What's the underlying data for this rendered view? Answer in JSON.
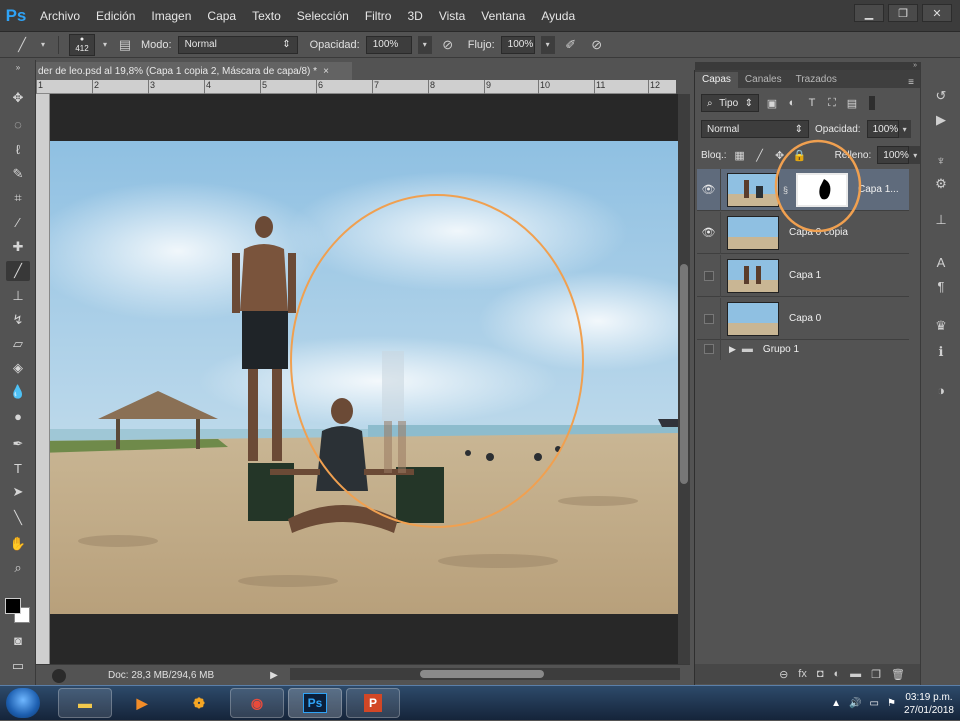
{
  "app": {
    "logo": "Ps",
    "menu": [
      "Archivo",
      "Edición",
      "Imagen",
      "Capa",
      "Texto",
      "Selección",
      "Filtro",
      "3D",
      "Vista",
      "Ventana",
      "Ayuda"
    ],
    "window_controls": [
      "minimize",
      "restore",
      "close"
    ]
  },
  "options_bar": {
    "brush_size": "412",
    "mode_label": "Modo:",
    "mode_value": "Normal",
    "opacity_label": "Opacidad:",
    "opacity_value": "100%",
    "flow_label": "Flujo:",
    "flow_value": "100%"
  },
  "document": {
    "tab_title": "der de leo.psd al 19,8% (Capa 1 copia 2, Máscara de capa/8) *",
    "close": "×",
    "ruler_numbers": [
      "1",
      "2",
      "3",
      "4",
      "5",
      "6",
      "7",
      "8",
      "9",
      "10",
      "11",
      "12"
    ],
    "status": "Doc: 28,3 MB/294,6 MB"
  },
  "layers_panel": {
    "tabs": [
      "Capas",
      "Canales",
      "Trazados"
    ],
    "filter_value": "Tipo",
    "blend_value": "Normal",
    "opacity_label": "Opacidad:",
    "opacity_value": "100%",
    "lock_label": "Bloq.:",
    "fill_label": "Relleno:",
    "fill_value": "100%",
    "layers": [
      {
        "name": "Capa 1...",
        "visible": true,
        "selected": true,
        "has_mask": true
      },
      {
        "name": "Capa 0 copia",
        "visible": true,
        "selected": false,
        "has_mask": false
      },
      {
        "name": "Capa 1",
        "visible": false,
        "selected": false,
        "has_mask": false
      },
      {
        "name": "Capa 0",
        "visible": false,
        "selected": false,
        "has_mask": false
      }
    ],
    "group_name": "Grupo 1",
    "bottom_icons": [
      "link-icon",
      "fx-icon",
      "mask-icon",
      "adjustment-icon",
      "folder-icon",
      "new-layer-icon",
      "trash-icon"
    ]
  },
  "taskbar": {
    "apps": [
      "explorer",
      "media-player",
      "fl-studio",
      "chrome",
      "photoshop",
      "powerpoint"
    ],
    "time": "03:19 p.m.",
    "date": "27/01/2018"
  },
  "colors": {
    "ps_blue": "#2fa3f6",
    "selected_layer": "#5f6b7c",
    "annotation_orange": "#f0a050"
  }
}
